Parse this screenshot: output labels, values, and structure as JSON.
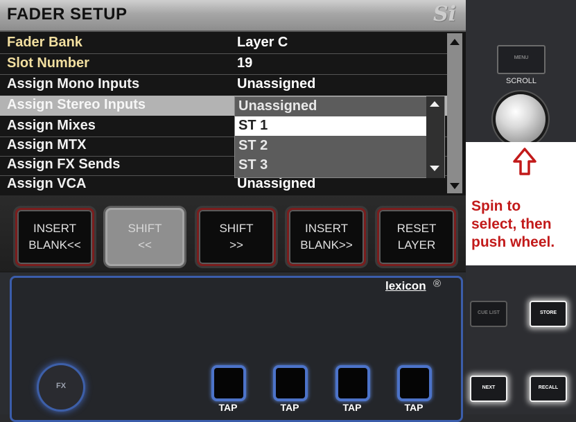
{
  "screen": {
    "title": "FADER SETUP",
    "logo": "Si",
    "params": [
      {
        "label": "Fader Bank",
        "value": "Layer C"
      },
      {
        "label": "Slot Number",
        "value": "19"
      },
      {
        "label": "Assign Mono Inputs",
        "value": "Unassigned"
      },
      {
        "label": "Assign Stereo Inputs",
        "value": "Unassigned"
      },
      {
        "label": "Assign Mixes",
        "value": ""
      },
      {
        "label": "Assign MTX",
        "value": ""
      },
      {
        "label": "Assign FX Sends",
        "value": ""
      },
      {
        "label": "Assign VCA",
        "value": "Unassigned"
      }
    ],
    "dropdown": {
      "items": [
        "Unassigned",
        "ST 1",
        "ST 2",
        "ST 3"
      ],
      "highlighted_index": 1
    },
    "softkeys": [
      {
        "line1": "INSERT",
        "line2": "BLANK<<",
        "state": "enabled"
      },
      {
        "line1": "SHIFT",
        "line2": "<<",
        "state": "disabled"
      },
      {
        "line1": "SHIFT",
        "line2": ">>",
        "state": "enabled"
      },
      {
        "line1": "INSERT",
        "line2": "BLANK>>",
        "state": "enabled"
      },
      {
        "line1": "RESET",
        "line2": "LAYER",
        "state": "enabled"
      }
    ]
  },
  "right_panel": {
    "menu_button": "MENU",
    "scroll_label": "SCROLL",
    "callout": {
      "lines": [
        "Spin to",
        "select, then",
        "push wheel."
      ],
      "color": "#c21a1a",
      "icon": "up-arrow-icon"
    }
  },
  "fx_panel": {
    "brand": "lexicon",
    "reg_mark": "®",
    "fx_knob_label": "FX",
    "tap_labels": [
      "TAP",
      "TAP",
      "TAP",
      "TAP"
    ],
    "accent_color": "#3b5dab"
  },
  "hardware_buttons": {
    "cue_list": "CUE LIST",
    "store": "STORE",
    "next": "NEXT",
    "recall": "RECALL"
  }
}
